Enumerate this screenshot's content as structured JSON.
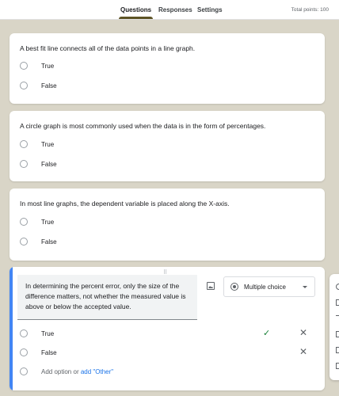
{
  "tabs": [
    {
      "label": "Questions",
      "active": true
    },
    {
      "label": "Responses",
      "active": false
    },
    {
      "label": "Settings",
      "active": false
    }
  ],
  "total_points": "Total points: 100",
  "questions": [
    {
      "title": "A best fit line connects all of the data points in a line graph.",
      "options": [
        "True",
        "False"
      ]
    },
    {
      "title": "A circle graph is most commonly used when the data is in the form of percentages.",
      "options": [
        "True",
        "False"
      ]
    },
    {
      "title": "In most line graphs, the dependent variable is placed along the X-axis.",
      "options": [
        "True",
        "False"
      ]
    }
  ],
  "active_question": {
    "title": "In determining the percent error, only the size of the difference matters, not whether the measured value is above or below the accepted value.",
    "type": "Multiple choice",
    "options": [
      "True",
      "False"
    ],
    "correct_option": "True",
    "add_option": "Add option",
    "or_text": "or",
    "add_other": "add \"Other\""
  },
  "colors": {
    "accent": "#4285f4",
    "tab_underline": "#5d5325",
    "background": "#d9d5c7",
    "check": "#188038",
    "link": "#1a73e8"
  },
  "icons": [
    "image-icon",
    "radio-icon",
    "dropdown-arrow-icon",
    "check-icon",
    "close-icon",
    "drag-handle-icon"
  ]
}
